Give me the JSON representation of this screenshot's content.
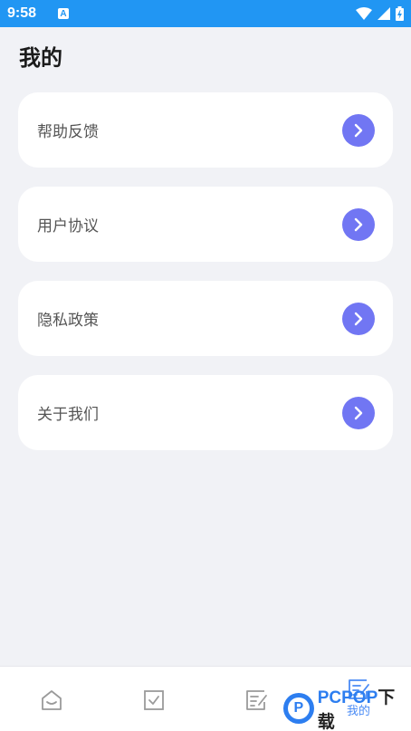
{
  "status_bar": {
    "time": "9:58",
    "notification_letter": "A"
  },
  "page": {
    "title": "我的"
  },
  "menu": {
    "items": [
      {
        "label": "帮助反馈",
        "icon": "chevron-right-icon"
      },
      {
        "label": "用户协议",
        "icon": "chevron-right-icon"
      },
      {
        "label": "隐私政策",
        "icon": "chevron-right-icon"
      },
      {
        "label": "关于我们",
        "icon": "chevron-right-icon"
      }
    ]
  },
  "bottom_nav": {
    "items": [
      {
        "icon": "home-icon",
        "label": ""
      },
      {
        "icon": "checkbox-icon",
        "label": ""
      },
      {
        "icon": "note-edit-icon",
        "label": ""
      },
      {
        "icon": "note-edit-icon",
        "label": "我的",
        "active": true
      }
    ]
  },
  "watermark": {
    "logo_letter": "P",
    "brand": "PCPOP",
    "suffix": "下载"
  },
  "colors": {
    "status_bar": "#2196f3",
    "accent": "#7176f3",
    "active_tab": "#4a8bf5",
    "background": "#f1f2f6"
  }
}
